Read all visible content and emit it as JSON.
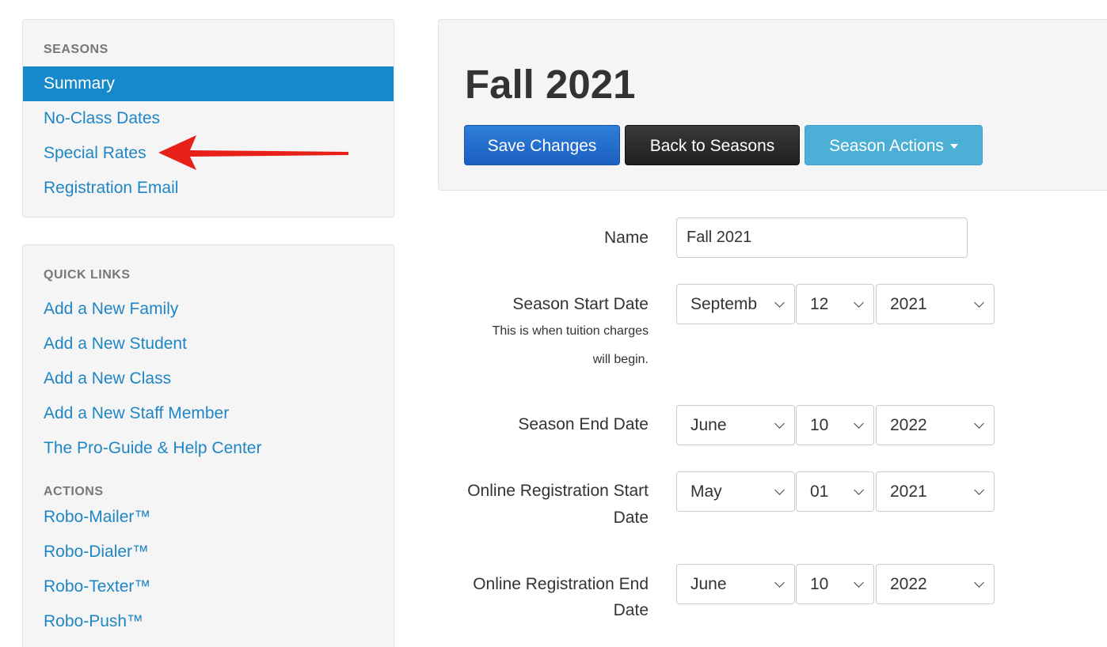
{
  "sidebar": {
    "seasons_header": "SEASONS",
    "seasons_items": [
      {
        "label": "Summary",
        "active": true
      },
      {
        "label": "No-Class Dates"
      },
      {
        "label": "Special Rates"
      },
      {
        "label": "Registration Email"
      }
    ],
    "quick_links_header": "QUICK LINKS",
    "quick_links": [
      {
        "label": "Add a New Family"
      },
      {
        "label": "Add a New Student"
      },
      {
        "label": "Add a New Class"
      },
      {
        "label": "Add a New Staff Member"
      },
      {
        "label": "The Pro-Guide & Help Center"
      }
    ],
    "actions_header": "ACTIONS",
    "actions": [
      {
        "label": "Robo-Mailer™"
      },
      {
        "label": "Robo-Dialer™"
      },
      {
        "label": "Robo-Texter™"
      },
      {
        "label": "Robo-Push™"
      }
    ]
  },
  "header": {
    "title": "Fall 2021",
    "save_label": "Save Changes",
    "back_label": "Back to Seasons",
    "actions_label": "Season Actions"
  },
  "form": {
    "name_label": "Name",
    "name_value": "Fall 2021",
    "start_label": "Season Start Date",
    "start_help_1": "This is when tuition charges",
    "start_help_2": "will begin.",
    "start_month": "Septemb",
    "start_day": "12",
    "start_year": "2021",
    "end_label": "Season End Date",
    "end_month": "June",
    "end_day": "10",
    "end_year": "2022",
    "reg_start_label_1": "Online Registration Start",
    "reg_start_label_2": "Date",
    "reg_start_month": "May",
    "reg_start_day": "01",
    "reg_start_year": "2021",
    "reg_end_label_1": "Online Registration End",
    "reg_end_label_2": "Date",
    "reg_end_month": "June",
    "reg_end_day": "10",
    "reg_end_year": "2022"
  },
  "colors": {
    "active_nav": "#1589c9",
    "link": "#1f86c6",
    "save_button": "#1b5fc2",
    "back_button": "#1f1f1f",
    "actions_button": "#4cb0d6",
    "annotation_arrow": "#e8201a"
  }
}
